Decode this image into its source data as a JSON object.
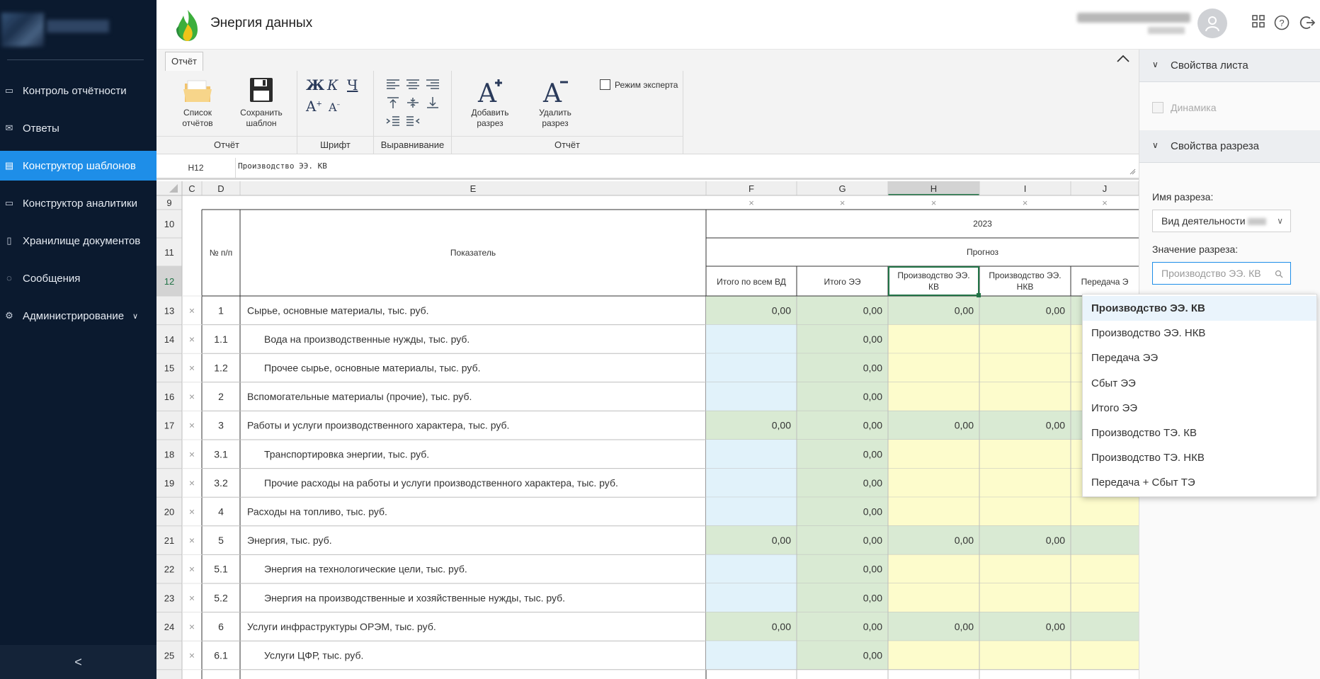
{
  "app": {
    "title": "Энергия данных"
  },
  "sidebar": {
    "items": [
      {
        "label": "Контроль отчётности",
        "icon": "calendar-icon"
      },
      {
        "label": "Ответы",
        "icon": "mail-icon"
      },
      {
        "label": "Конструктор шаблонов",
        "icon": "template-icon",
        "active": true
      },
      {
        "label": "Конструктор аналитики",
        "icon": "analytics-icon"
      },
      {
        "label": "Хранилище документов",
        "icon": "document-storage-icon"
      },
      {
        "label": "Сообщения",
        "icon": "chat-icon"
      },
      {
        "label": "Администрирование",
        "icon": "gear-icon"
      }
    ],
    "collapse_icon": "<"
  },
  "ribbon": {
    "tab": "Отчёт",
    "list_reports": "Список отчётов",
    "save_template": "Сохранить шаблон",
    "group_report": "Отчёт",
    "group_font": "Шрифт",
    "group_align": "Выравнивание",
    "group_report2": "Отчёт",
    "bold": "Ж",
    "italic": "К",
    "underline": "Ч",
    "add_slice": "Добавить разрез",
    "delete_slice": "Удалить разрез",
    "expert_mode": "Режим эксперта"
  },
  "formula_bar": {
    "cell": "H12",
    "value": "Производство ЭЭ. КВ"
  },
  "sheet": {
    "col_letters": [
      "C",
      "D",
      "E",
      "F",
      "G",
      "H",
      "I",
      "J"
    ],
    "rows": [
      "9",
      "10",
      "11",
      "12",
      "13",
      "14",
      "15",
      "16",
      "17",
      "18",
      "19",
      "20",
      "21",
      "22",
      "23",
      "24",
      "25"
    ],
    "header_num": "№ п/п",
    "header_indicator": "Показатель",
    "header_year": "2023",
    "header_forecast": "Прогноз",
    "col_headers": [
      "Итого по всем ВД",
      "Итого ЭЭ",
      "Производство ЭЭ. КВ",
      "Производство ЭЭ. НКВ",
      "Передача Э"
    ],
    "data_rows": [
      {
        "num": "1",
        "name": "Сырье, основные материалы, тыс. руб.",
        "type": "total",
        "vals": [
          "0,00",
          "0,00",
          "0,00",
          "0,00"
        ]
      },
      {
        "num": "1.1",
        "name": "Вода на производственные нужды, тыс. руб.",
        "type": "sub",
        "vals": [
          "",
          "0,00",
          "",
          ""
        ]
      },
      {
        "num": "1.2",
        "name": "Прочее сырье, основные материалы, тыс. руб.",
        "type": "sub",
        "vals": [
          "",
          "0,00",
          "",
          ""
        ]
      },
      {
        "num": "2",
        "name": "Вспомогательные материалы (прочие), тыс. руб.",
        "type": "plain",
        "vals": [
          "",
          "0,00",
          "",
          ""
        ]
      },
      {
        "num": "3",
        "name": "Работы и услуги производственного характера, тыс. руб.",
        "type": "total",
        "vals": [
          "0,00",
          "0,00",
          "0,00",
          "0,00"
        ]
      },
      {
        "num": "3.1",
        "name": "Транспортировка энергии, тыс. руб.",
        "type": "sub",
        "vals": [
          "",
          "0,00",
          "",
          ""
        ]
      },
      {
        "num": "3.2",
        "name": "Прочие расходы на работы и услуги производственного характера, тыс. руб.",
        "type": "sub",
        "vals": [
          "",
          "0,00",
          "",
          ""
        ]
      },
      {
        "num": "4",
        "name": "Расходы на топливо, тыс. руб.",
        "type": "plain",
        "vals": [
          "",
          "0,00",
          "",
          ""
        ]
      },
      {
        "num": "5",
        "name": "Энергия, тыс. руб.",
        "type": "total",
        "vals": [
          "0,00",
          "0,00",
          "0,00",
          "0,00"
        ]
      },
      {
        "num": "5.1",
        "name": "Энергия на технологические цели, тыс. руб.",
        "type": "sub",
        "vals": [
          "",
          "0,00",
          "",
          ""
        ]
      },
      {
        "num": "5.2",
        "name": "Энергия на производственные и хозяйственные нужды, тыс. руб.",
        "type": "sub",
        "vals": [
          "",
          "0,00",
          "",
          ""
        ]
      },
      {
        "num": "6",
        "name": "Услуги инфраструктуры ОРЭМ, тыс. руб.",
        "type": "total",
        "vals": [
          "0,00",
          "0,00",
          "0,00",
          "0,00"
        ]
      },
      {
        "num": "6.1",
        "name": "Услуги ЦФР, тыс. руб.",
        "type": "sub",
        "vals": [
          "",
          "0,00",
          "",
          ""
        ]
      }
    ],
    "colors": {
      "green": "#d9ead3",
      "blue": "#e1f2fa",
      "yellow": "#fdfccc",
      "selected": "#217346"
    }
  },
  "right_panel": {
    "sheet_props": "Свойства листа",
    "dynamics": "Динамика",
    "slice_props": "Свойства разреза",
    "slice_name_label": "Имя разреза:",
    "slice_name_value": "Вид деятельности",
    "slice_value_label": "Значение разреза:",
    "slice_value_placeholder": "Производство ЭЭ. КВ"
  },
  "dropdown": {
    "options": [
      "Производство ЭЭ. КВ",
      "Производство ЭЭ. НКВ",
      "Передача ЭЭ",
      "Сбыт ЭЭ",
      "Итого ЭЭ",
      "Производство ТЭ. КВ",
      "Производство ТЭ. НКВ",
      "Передача + Сбыт ТЭ"
    ],
    "selected": 0
  }
}
